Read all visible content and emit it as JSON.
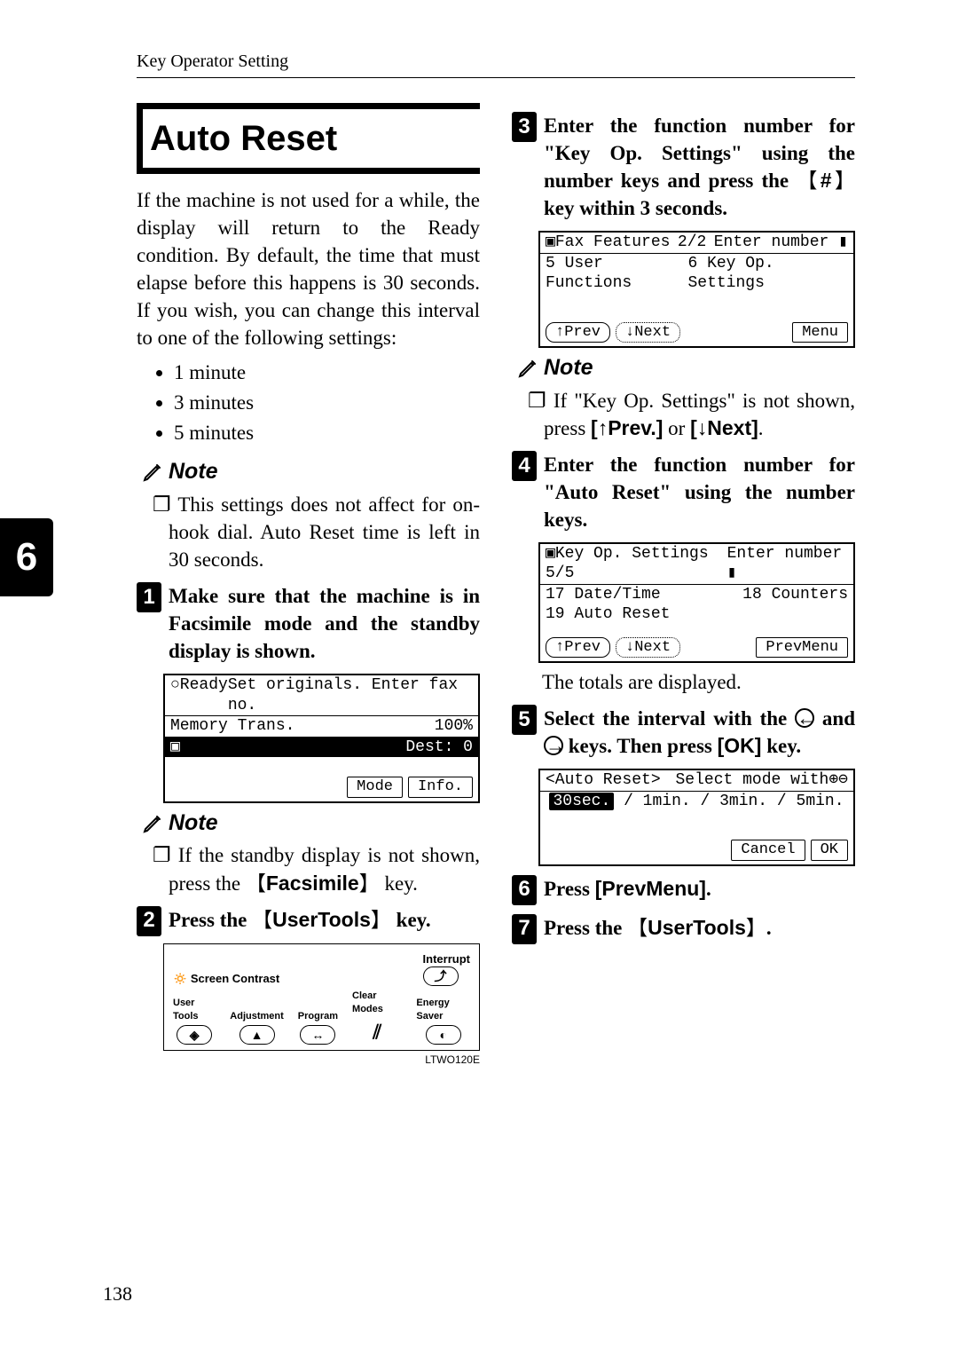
{
  "header": {
    "title": "Key Operator Setting"
  },
  "sidebar": {
    "tab": "6"
  },
  "left": {
    "heading": "Auto Reset",
    "intro": "If the machine is not used for a while, the display will return to the Ready condition. By default, the time that must elapse before this happens is 30 seconds. If you wish, you can change this interval to one of the following settings:",
    "options": [
      "1 minute",
      "3 minutes",
      "5 minutes"
    ],
    "note_label": "Note",
    "note1": "This settings does not affect for on-hook dial. Auto Reset time is left in 30 seconds.",
    "step1": "Make sure that the machine is in Facsimile mode and the standby display is shown.",
    "lcd1": {
      "line1a": "○Ready",
      "line1b": "Set originals. Enter fax no.",
      "line2a": "Memory Trans.",
      "line2b": "100%",
      "line3a": "▣",
      "line3b": "Dest:  0",
      "btn1": "Mode",
      "btn2": "Info."
    },
    "note2a": "If the standby display is not shown, press the ",
    "note2_key": "Facsimile",
    "note2b": " key.",
    "step2a": "Press the ",
    "step2_key": "UserTools",
    "step2b": " key.",
    "panel": {
      "screen_contrast": "Screen Contrast",
      "interrupt": "Interrupt",
      "b1": "User Tools",
      "b2": "Adjustment",
      "b3": "Program",
      "b4": "Clear Modes",
      "b5": "Energy Saver",
      "code": "LTWO120E"
    }
  },
  "right": {
    "step3a": "Enter the function number for \"Key Op. Settings\" using the number keys and press the ",
    "step3_key": "#",
    "step3b": " key within 3 seconds.",
    "lcd2": {
      "title": "▣Fax Features",
      "pg": "2/2",
      "hint": "Enter number ▮",
      "l1": "5 User Functions",
      "l2": "6 Key Op. Settings",
      "btnPrev": "↑Prev",
      "btnNext": "↓Next",
      "btnMenu": "Menu"
    },
    "note_label": "Note",
    "note3a": "If \"Key Op. Settings\" is not shown, press ",
    "note3_k1": "[↑Prev.]",
    "note3_mid": " or ",
    "note3_k2": "[↓Next]",
    "note3_end": ".",
    "step4": "Enter the function number for \"Auto Reset\" using the number keys.",
    "lcd3": {
      "title": "▣Key Op. Settings",
      "pg": "5/5",
      "hint": "Enter number ▮",
      "l1": "17 Date/Time",
      "l2": "18 Counters",
      "l3": "19 Auto Reset",
      "btnPrev": "↑Prev",
      "btnNext": "↓Next",
      "btnPM": "PrevMenu"
    },
    "after4": "The totals are displayed.",
    "step5a": "Select the interval with the ",
    "step5b": " and ",
    "step5c": " keys. Then press ",
    "step5_ok": "[OK]",
    "step5d": " key.",
    "lcd4": {
      "title": "<Auto Reset>",
      "hint": "Select mode with⊕⊖",
      "opts_sel": "30sec.",
      "opts_rest": " / 1min. / 3min. / 5min.",
      "btnCancel": "Cancel",
      "btnOK": "OK"
    },
    "step6a": "Press ",
    "step6_key": "[PrevMenu]",
    "step6b": ".",
    "step7a": "Press the ",
    "step7_key": "UserTools",
    "step7b": "."
  },
  "footer": {
    "page_number": "138"
  }
}
